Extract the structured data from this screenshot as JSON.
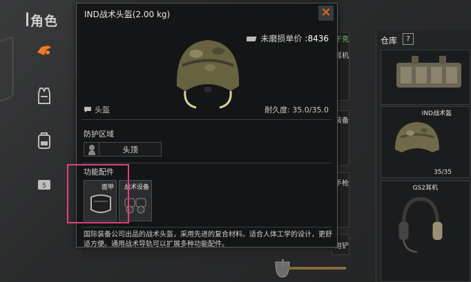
{
  "sidebar": {
    "title": "角色",
    "icons": [
      "weapon-icon",
      "vest-icon",
      "backpack-icon",
      "item-icon"
    ]
  },
  "background": {
    "mid_labels": [
      "于克",
      "耳机",
      "装备",
      "手枪",
      "用铲"
    ]
  },
  "warehouse": {
    "title": "仓库",
    "help": "?",
    "items": [
      {
        "name": "IND战术盔",
        "durability": "35/35"
      },
      {
        "name": "GS2耳机"
      }
    ]
  },
  "popup": {
    "title": "IND战术头盔(2.00 kg)",
    "close": "✕",
    "price_label": "未磨损单价",
    "price_value": ":8436",
    "type": "头盔",
    "durability": "耐久度: 35.0/35.0",
    "protect_title": "防护区域",
    "protect_zone": "头顶",
    "attach_title": "功能配件",
    "attachments": [
      {
        "label": "面甲"
      },
      {
        "label": "战术设备"
      }
    ],
    "description": "国际装备公司出品的战术头盔，采用先进的复合材料。适合人体工学的设计，更舒适方便。通用战术导轨可以扩展多种功能配件。"
  },
  "colors": {
    "accent_close": "#ff6a2a",
    "highlight": "#e0418a",
    "weapon_icon": "#f07a2a"
  }
}
